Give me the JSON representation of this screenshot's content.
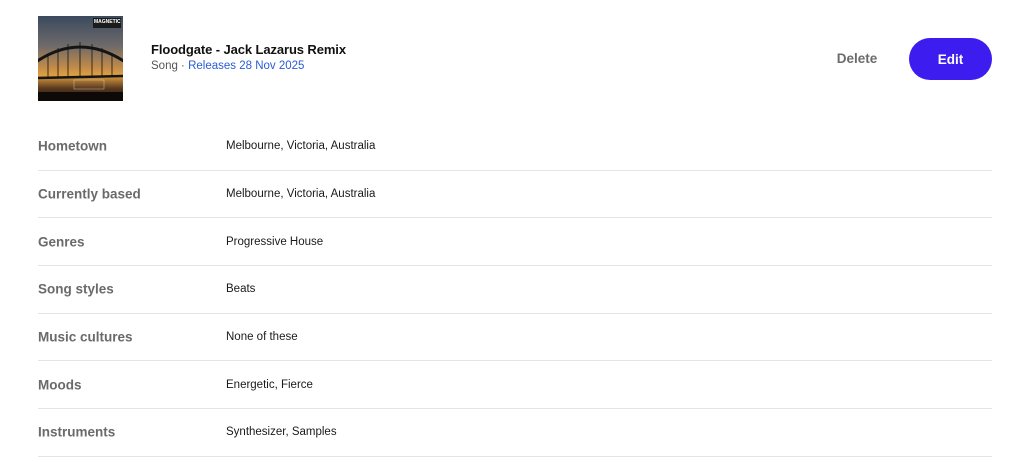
{
  "song": {
    "title": "Floodgate - Jack Lazarus Remix",
    "type_prefix": "Song · ",
    "release": "Releases 28 Nov 2025",
    "cover_logo_text": "MAGNETIC"
  },
  "actions": {
    "delete_label": "Delete",
    "edit_label": "Edit"
  },
  "details": [
    {
      "label": "Hometown",
      "value": "Melbourne, Victoria, Australia"
    },
    {
      "label": "Currently based",
      "value": "Melbourne, Victoria, Australia"
    },
    {
      "label": "Genres",
      "value": "Progressive House"
    },
    {
      "label": "Song styles",
      "value": "Beats"
    },
    {
      "label": "Music cultures",
      "value": "None of these"
    },
    {
      "label": "Moods",
      "value": "Energetic, Fierce"
    },
    {
      "label": "Instruments",
      "value": "Synthesizer, Samples"
    }
  ],
  "colors": {
    "accent": "#3d1cf0",
    "release_link": "#2a5bd7",
    "label_text": "#6a6a6a",
    "divider": "#e4e4e4"
  }
}
